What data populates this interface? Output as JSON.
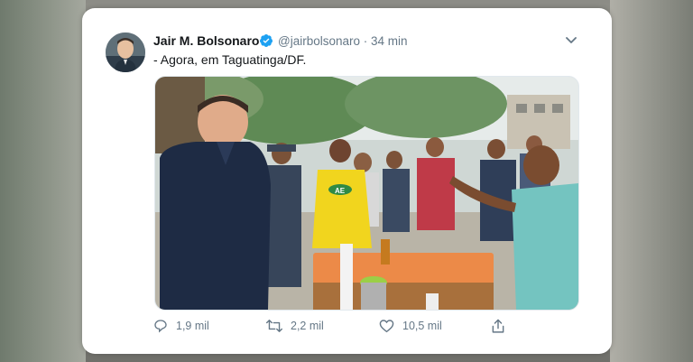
{
  "tweet": {
    "author_name": "Jair M. Bolsonaro",
    "handle": "@jairbolsonaro",
    "separator": "·",
    "time": "34 min",
    "text": "- Agora, em Taguatinga/DF."
  },
  "actions": {
    "reply_count": "1,9 mil",
    "retweet_count": "2,2 mil",
    "like_count": "10,5 mil"
  },
  "media": {
    "shirt_text": "AE"
  },
  "icons": {
    "verified": "verified-badge-icon",
    "menu": "chevron-down-icon",
    "reply": "reply-icon",
    "retweet": "retweet-icon",
    "like": "heart-icon",
    "share": "share-icon"
  },
  "colors": {
    "verified_blue": "#1da1f2",
    "text_primary": "#14171a",
    "text_secondary": "#657786"
  }
}
